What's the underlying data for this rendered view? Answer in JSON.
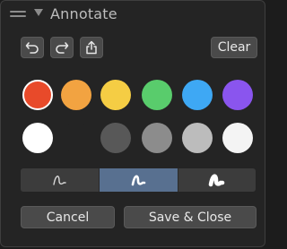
{
  "panel": {
    "title": "Annotate",
    "icons": {
      "drag": "drag-handle-icon",
      "collapse": "chevron-down-icon"
    }
  },
  "toolbar": {
    "undo_icon": "undo-icon",
    "redo_icon": "redo-icon",
    "share_icon": "share-icon",
    "clear_label": "Clear"
  },
  "colors": {
    "row1": [
      "#e84a2a",
      "#f2a341",
      "#f5cd44",
      "#59cc6c",
      "#3ea8f4",
      "#8a55ee"
    ],
    "row2": [
      "#ffffff",
      "#242424",
      "#585858",
      "#8c8c8c",
      "#bcbcbc",
      "#f4f4f4"
    ],
    "selected": "#e84a2a"
  },
  "stroke": {
    "options": [
      "thin",
      "medium",
      "thick"
    ],
    "selected": "medium",
    "icons": [
      "thin-stroke-icon",
      "medium-stroke-icon",
      "thick-stroke-icon"
    ]
  },
  "actions": {
    "cancel_label": "Cancel",
    "save_label": "Save & Close"
  },
  "style": {
    "panel_bg": "#242424",
    "button_bg": "#4a4a4a",
    "active_accent": "#587090"
  }
}
